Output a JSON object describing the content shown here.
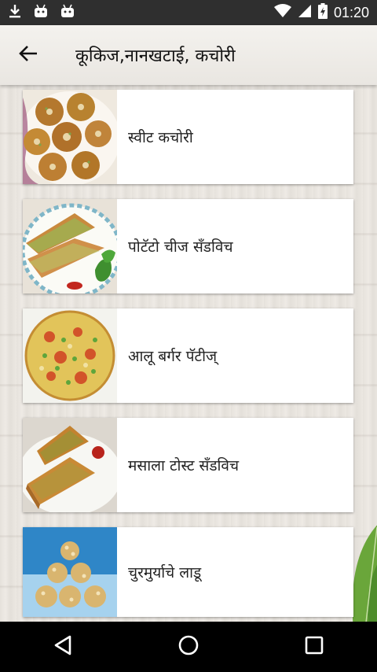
{
  "status_bar": {
    "time": "01:20",
    "left_icons": [
      "download-icon",
      "android-notification-icon",
      "android-notification-icon"
    ],
    "right_icons": [
      "wifi-icon",
      "signal-icon",
      "battery-charging-icon"
    ]
  },
  "app_bar": {
    "title": "कूकिज,नानखटाई, कचोरी",
    "back_icon": "arrow-left-icon"
  },
  "recipes": [
    {
      "label": "स्वीट कचोरी",
      "thumb": "sweet-kachori"
    },
    {
      "label": "पोटॅटो चीज सॅंडविच",
      "thumb": "potato-cheese-sandwich"
    },
    {
      "label": "आलू बर्गर पॅटीज्",
      "thumb": "aloo-burger-patties"
    },
    {
      "label": "मसाला टोस्ट सॅंडविच",
      "thumb": "masala-toast-sandwich"
    },
    {
      "label": "चुरमुर्याचे लाडू",
      "thumb": "churmuryache-ladoo"
    }
  ],
  "nav_bar": {
    "buttons": [
      "back-triangle-icon",
      "home-circle-icon",
      "recents-square-icon"
    ]
  }
}
